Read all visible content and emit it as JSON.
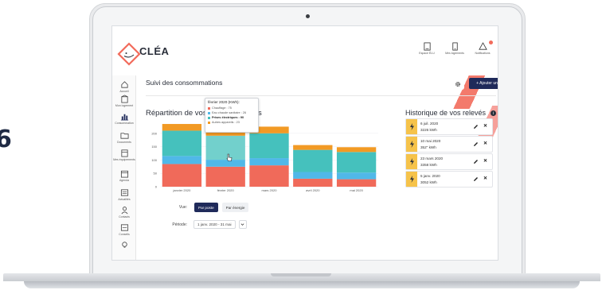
{
  "app": {
    "logo_text": "CLÉA",
    "page_title": "Suivi des consommations"
  },
  "topbar": {
    "icons": [
      {
        "name": "espace-elu-icon",
        "label": "Espace ÉLU"
      },
      {
        "name": "mes-logements-icon",
        "label": "Mes logements"
      },
      {
        "name": "notifications-icon",
        "label": "Notifications"
      }
    ]
  },
  "sidebar": {
    "items": [
      {
        "name": "accueil",
        "label": "Accueil"
      },
      {
        "name": "mon-logement",
        "label": "Mon logement"
      },
      {
        "name": "consommation",
        "label": "Consommation"
      },
      {
        "name": "documents",
        "label": "Documents"
      },
      {
        "name": "mes-equipements",
        "label": "Mes équipements"
      },
      {
        "name": "agenda",
        "label": "Agenda"
      },
      {
        "name": "actualites",
        "label": "Actualités"
      },
      {
        "name": "contacts",
        "label": "Contacts"
      },
      {
        "name": "conseils",
        "label": "Conseils"
      }
    ]
  },
  "toolbar": {
    "add_label": "+ Ajouter un relevé"
  },
  "chart_section": {
    "title": "Répartition de vos consommations",
    "view_label": "Vue:",
    "view_options": [
      "Par poste",
      "Par énergie"
    ],
    "view_selected": "Par poste",
    "period_label": "Période:",
    "period_value": "1 janv. 2020 - 31 mai"
  },
  "tooltip": {
    "title": "février 2020 (KWh):",
    "rows": [
      {
        "label": "Chauffage : 75",
        "color": "#f06a5a"
      },
      {
        "label": "Eau chaude sanitaire : 26",
        "color": "#50b8e8"
      },
      {
        "label": "Prises électriques : 90",
        "color": "#45c1bd"
      },
      {
        "label": "Autres appareils : 23",
        "color": "#f29a24"
      }
    ]
  },
  "chart_data": {
    "type": "bar",
    "stacked": true,
    "categories": [
      "janvier 2020",
      "février 2020",
      "mars 2020",
      "avril 2020",
      "mai 2020"
    ],
    "series": [
      {
        "name": "Chauffage",
        "color": "#f06a5a",
        "values": [
          85,
          75,
          80,
          30,
          28
        ]
      },
      {
        "name": "Eau chaude sanitaire",
        "color": "#50b8e8",
        "values": [
          30,
          26,
          27,
          25,
          25
        ]
      },
      {
        "name": "Prises électriques",
        "color": "#45c1bd",
        "values": [
          95,
          90,
          93,
          83,
          77
        ]
      },
      {
        "name": "Autres appareils",
        "color": "#f29a24",
        "values": [
          25,
          23,
          25,
          18,
          18
        ]
      }
    ],
    "yticks": [
      0,
      50,
      100,
      150,
      200
    ],
    "ylim": [
      0,
      250
    ],
    "highlight_index": 1
  },
  "history": {
    "title": "Historique de vos relevés",
    "items": [
      {
        "date": "6 juil. 2020",
        "value": "3226 kWh"
      },
      {
        "date": "10 mai 2020",
        "value": "352\" kWh"
      },
      {
        "date": "23 mars 2020",
        "value": "3358 kWh"
      },
      {
        "date": "5 janv. 2020",
        "value": "3052 kWh"
      }
    ]
  }
}
